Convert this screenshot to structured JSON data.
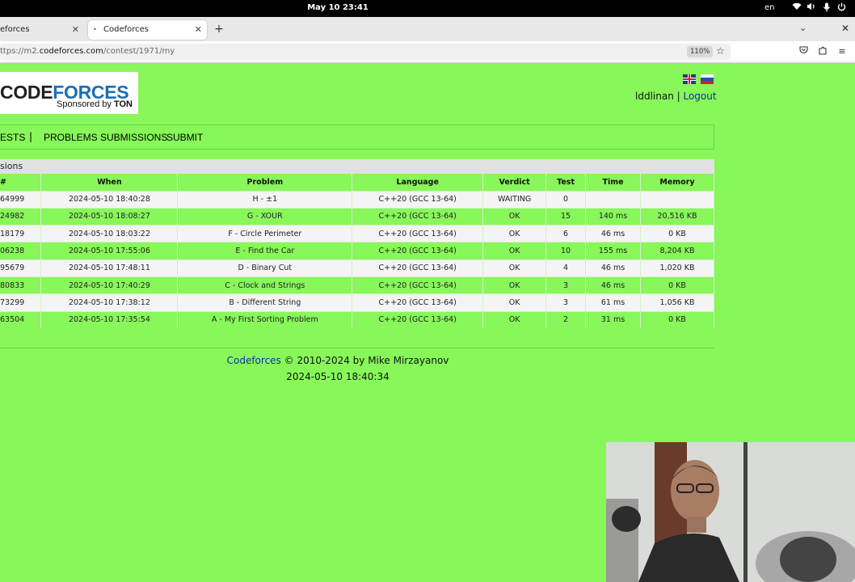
{
  "topbar": {
    "clock": "May 10  23:41",
    "lang": "en"
  },
  "tabs": {
    "inactive_title": "eforces",
    "active_title": "Codeforces",
    "new_tab": "+"
  },
  "url": {
    "prefix": "ttps://m2.",
    "host": "codeforces.com",
    "path": "/contest/1971/my",
    "zoom": "110%"
  },
  "user": {
    "handle": "lddlinan",
    "separator": " | ",
    "logout": "Logout"
  },
  "logo": {
    "word_c": "C",
    "word_ode": "ODE",
    "word_forces": "FORCES",
    "sponsor_prefix": "Sponsored by ",
    "sponsor_name": "TON"
  },
  "menu": {
    "contests": "ESTS",
    "sep": "|",
    "problems": "PROBLEMS",
    "submissions": "SUBMISSIONS",
    "submit": "SUBMIT"
  },
  "submissions": {
    "caption": "sions",
    "headers": [
      "#",
      "When",
      "Problem",
      "Language",
      "Verdict",
      "Test",
      "Time",
      "Memory"
    ],
    "rows": [
      [
        "64999",
        "2024-05-10 18:40:28",
        "H - ±1",
        "C++20 (GCC 13-64)",
        "WAITING",
        "0",
        "",
        ""
      ],
      [
        "24982",
        "2024-05-10 18:08:27",
        "G - XOUR",
        "C++20 (GCC 13-64)",
        "OK",
        "15",
        "140 ms",
        "20,516 KB"
      ],
      [
        "18179",
        "2024-05-10 18:03:22",
        "F - Circle Perimeter",
        "C++20 (GCC 13-64)",
        "OK",
        "6",
        "46 ms",
        "0 KB"
      ],
      [
        "06238",
        "2024-05-10 17:55:06",
        "E - Find the Car",
        "C++20 (GCC 13-64)",
        "OK",
        "10",
        "155 ms",
        "8,204 KB"
      ],
      [
        "95679",
        "2024-05-10 17:48:11",
        "D - Binary Cut",
        "C++20 (GCC 13-64)",
        "OK",
        "4",
        "46 ms",
        "1,020 KB"
      ],
      [
        "80833",
        "2024-05-10 17:40:29",
        "C - Clock and Strings",
        "C++20 (GCC 13-64)",
        "OK",
        "3",
        "46 ms",
        "0 KB"
      ],
      [
        "73299",
        "2024-05-10 17:38:12",
        "B - Different String",
        "C++20 (GCC 13-64)",
        "OK",
        "3",
        "61 ms",
        "1,056 KB"
      ],
      [
        "63504",
        "2024-05-10 17:35:54",
        "A - My First Sorting Problem",
        "C++20 (GCC 13-64)",
        "OK",
        "2",
        "31 ms",
        "0 KB"
      ]
    ]
  },
  "footer": {
    "link": "Codeforces",
    "copyright": " © 2010-2024 by Mike Mirzayanov",
    "time": "2024-05-10 18:40:34"
  },
  "colors": {
    "page_bg": "#87f75a",
    "link": "#10309c",
    "logo_blue": "#1a6fb4"
  }
}
